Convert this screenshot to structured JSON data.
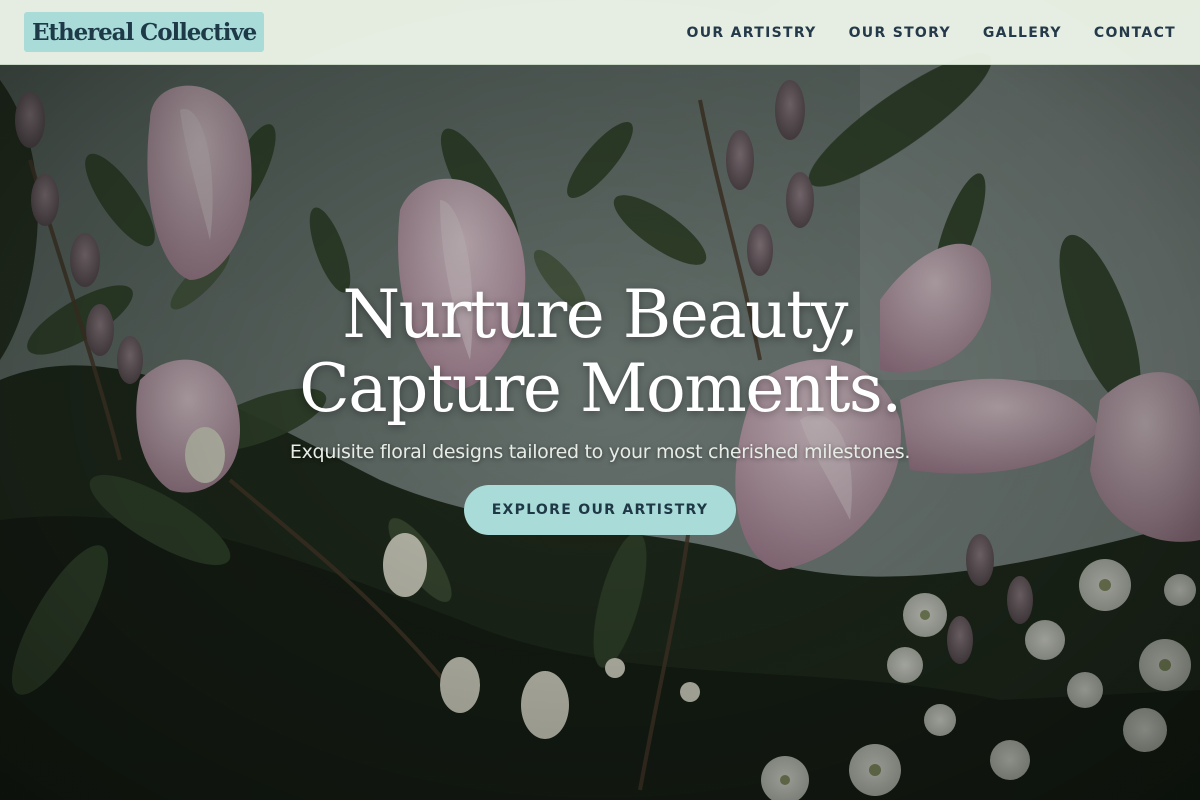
{
  "brand": {
    "name": "Ethereal Collective"
  },
  "nav": {
    "items": [
      {
        "label": "OUR ARTISTRY"
      },
      {
        "label": "OUR STORY"
      },
      {
        "label": "GALLERY"
      },
      {
        "label": "CONTACT"
      }
    ]
  },
  "hero": {
    "title_line1": "Nurture Beauty,",
    "title_line2": "Capture Moments.",
    "subtitle": "Exquisite floral designs tailored to your most cherished milestones.",
    "cta_label": "EXPLORE OUR ARTISTRY",
    "background_image": "floral-arrangement-lilies-pussy-willow"
  },
  "colors": {
    "accent": "#a9dcd9",
    "header_bg": "#ecf4e8",
    "text_dark": "#1e3a48",
    "hero_text": "#ffffff"
  }
}
